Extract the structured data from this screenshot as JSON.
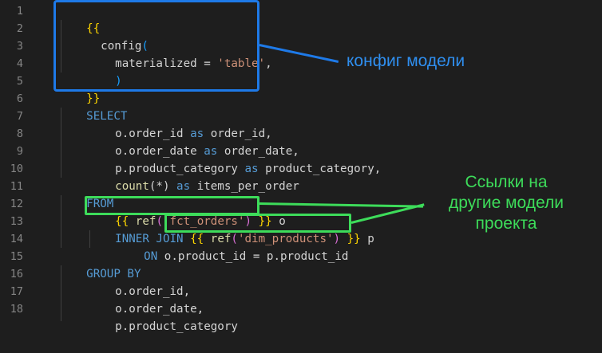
{
  "editor": {
    "line_numbers": [
      "1",
      "2",
      "3",
      "4",
      "5",
      "6",
      "7",
      "8",
      "9",
      "10",
      "11",
      "12",
      "13",
      "14",
      "15",
      "16",
      "17",
      "18"
    ],
    "code": {
      "l1_open": "{{",
      "l2_config": "config",
      "l2_paren": "(",
      "l3_key": "materialized = ",
      "l3_val": "'table'",
      "l3_comma": ",",
      "l4_paren": ")",
      "l5_close": "}}",
      "l6": "SELECT",
      "l7_a": "o.order_id ",
      "l7_as": "as",
      "l7_b": " order_id,",
      "l8_a": "o.order_date ",
      "l8_as": "as",
      "l8_b": " order_date,",
      "l9_a": "p.product_category ",
      "l9_as": "as",
      "l9_b": " product_category,",
      "l10_fn": "count",
      "l10_star": "(*)",
      "l10_as": " as",
      "l10_b": " items_per_order",
      "l11": "FROM",
      "l12_open": "{{",
      "l12_ref": " ref",
      "l12_lp": "(",
      "l12_str": "'fct_orders'",
      "l12_rp": ")",
      "l12_close": " }}",
      "l12_alias": " o",
      "l13_kw": "INNER JOIN ",
      "l13_open": "{{",
      "l13_ref": " ref",
      "l13_lp": "(",
      "l13_str": "'dim_products'",
      "l13_rp": ")",
      "l13_close": " }}",
      "l13_alias": " p",
      "l14_kw": "ON",
      "l14_rest": " o.product_id = p.product_id",
      "l15": "GROUP BY",
      "l16": "o.order_id,",
      "l17": "o.order_date,",
      "l18": "p.product_category"
    }
  },
  "annotations": {
    "model_config": "конфиг модели",
    "refs_line1": "Ссылки на",
    "refs_line2": "другие модели",
    "refs_line3": "проекта"
  },
  "colors": {
    "background": "#1e1e1e",
    "keyword": "#569cd6",
    "string": "#ce9178",
    "function": "#dcdcaa",
    "bracket_gold": "#ffd700",
    "bracket_purple": "#da70d6",
    "bracket_blue": "#179fff",
    "annotation_blue": "#1e7ae8",
    "annotation_green": "#3ddc5a"
  }
}
